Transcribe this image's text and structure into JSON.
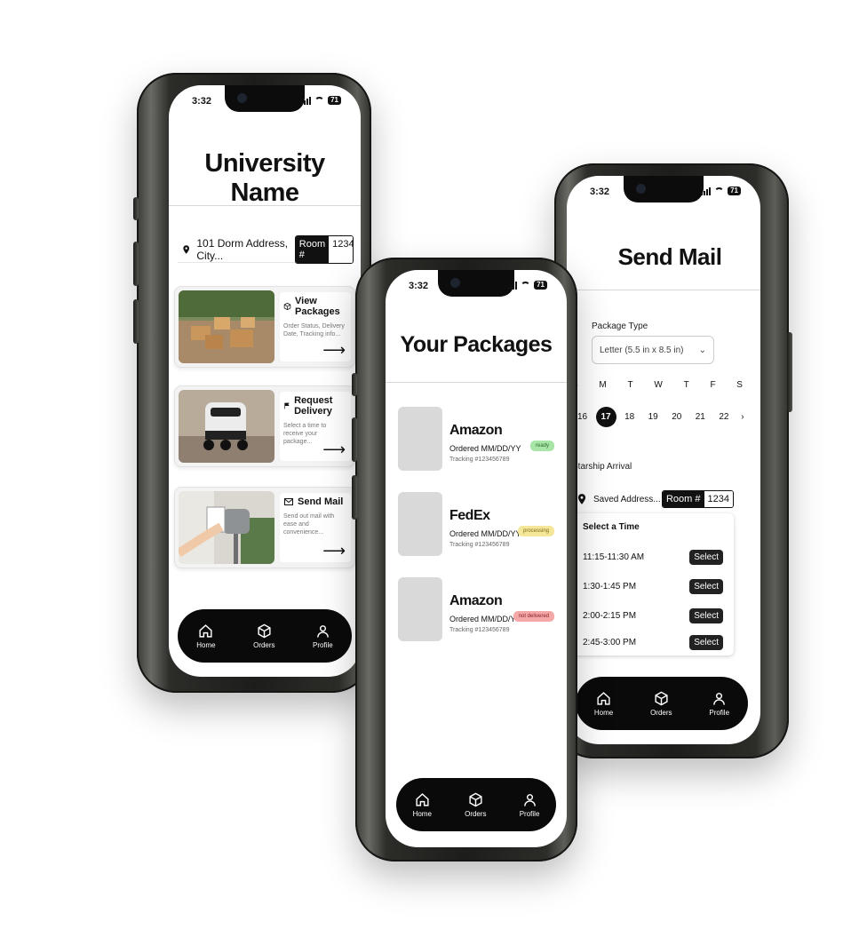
{
  "status": {
    "time": "3:32",
    "battery": "71"
  },
  "nav": [
    {
      "label": "Home",
      "icon": "home-icon"
    },
    {
      "label": "Orders",
      "icon": "box-icon"
    },
    {
      "label": "Profile",
      "icon": "user-icon"
    }
  ],
  "home": {
    "title": "University Name",
    "address": "101 Dorm Address, City...",
    "room_label": "Room #",
    "room_value": "1234",
    "cards": [
      {
        "title": "View Packages",
        "desc": "Order Status, Delivery Date, Tracking info...",
        "icon": "box-icon",
        "thumb": "packages-photo"
      },
      {
        "title": "Request Delivery",
        "desc": "Select a time to receive your package...",
        "icon": "flag-icon",
        "thumb": "robot-photo"
      },
      {
        "title": "Send Mail",
        "desc": "Send out mail with ease and convenience...",
        "icon": "mail-icon",
        "thumb": "mailbox-photo"
      }
    ],
    "arrow": "⟶"
  },
  "packages": {
    "title": "Your Packages",
    "items": [
      {
        "carrier": "Amazon",
        "ordered": "Ordered MM/DD/YY",
        "tracking": "Tracking #123456789",
        "status": "ready",
        "status_color": "#a8e6a8"
      },
      {
        "carrier": "FedEx",
        "ordered": "Ordered MM/DD/YY",
        "tracking": "Tracking #123456789",
        "status": "processing",
        "status_color": "#f5e79a"
      },
      {
        "carrier": "Amazon",
        "ordered": "Ordered MM/DD/YY",
        "tracking": "Tracking #123456789",
        "status": "not delivered",
        "status_color": "#f4a8a8"
      }
    ]
  },
  "send_mail": {
    "title": "Send Mail",
    "package_type_label": "Package Type",
    "package_type_value": "Letter (5.5 in x 8.5 in)",
    "weekdays": [
      "S",
      "M",
      "T",
      "W",
      "T",
      "F",
      "S"
    ],
    "dates": [
      "16",
      "17",
      "18",
      "19",
      "20",
      "21",
      "22"
    ],
    "selected_date": "17",
    "next_arrow": "›",
    "arrival_label": "Starship Arrival",
    "saved_address": "Saved Address...",
    "room_label": "Room #",
    "room_value": "1234",
    "time_header": "Select a Time",
    "slots": [
      "11:15-11:30 AM",
      "1:30-1:45 PM",
      "2:00-2:15 PM",
      "2:45-3:00 PM"
    ],
    "select_label": "Select"
  }
}
